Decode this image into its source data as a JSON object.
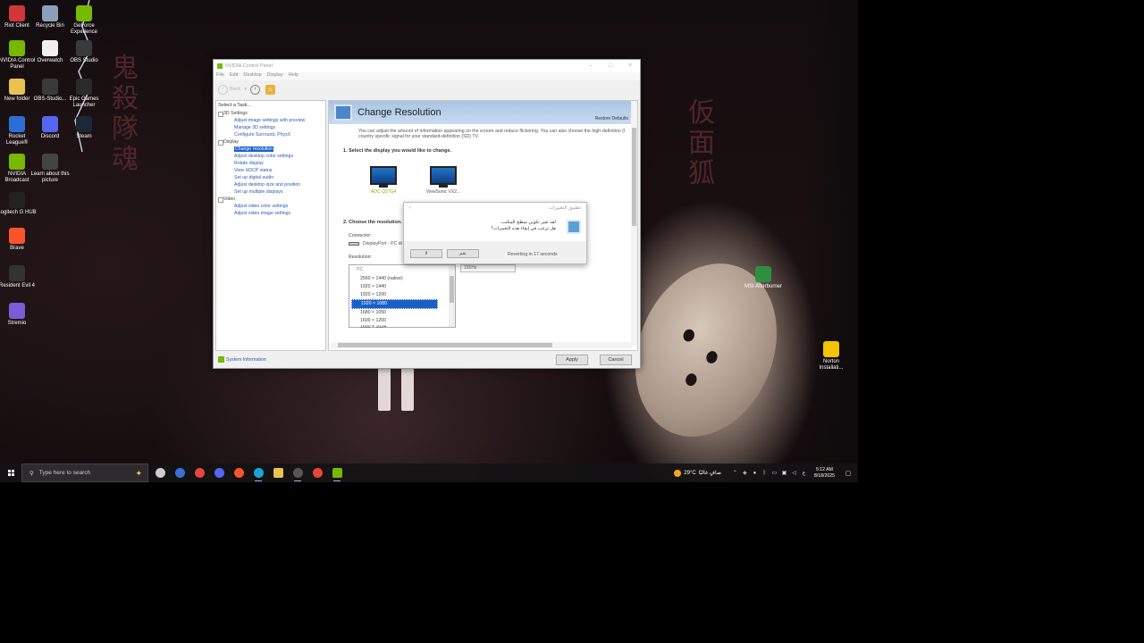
{
  "desktop": {
    "icons": [
      {
        "label": "Riot Client",
        "icon": "riot-client-icon",
        "color": "#d13639"
      },
      {
        "label": "Recycle Bin",
        "icon": "recycle-bin-icon",
        "color": "#8aa0b8"
      },
      {
        "label": "GeForce Experience",
        "icon": "geforce-experience-icon",
        "color": "#76b900"
      },
      {
        "label": "NVIDIA Control Panel",
        "icon": "nvidia-control-panel-icon",
        "color": "#76b900"
      },
      {
        "label": "Overwatch",
        "icon": "overwatch-icon",
        "color": "#f0f0f0"
      },
      {
        "label": "OBS Studio",
        "icon": "obs-studio-icon",
        "color": "#3a3a3a"
      },
      {
        "label": "New folder",
        "icon": "folder-icon",
        "color": "#e8c352"
      },
      {
        "label": "OBS-Studio...",
        "icon": "obs-studio-installer-icon",
        "color": "#3a3a3a"
      },
      {
        "label": "Epic Games Launcher",
        "icon": "epic-games-icon",
        "color": "#2a2a2a"
      },
      {
        "label": "Rocket League®",
        "icon": "rocket-league-icon",
        "color": "#2b6fd6"
      },
      {
        "label": "Discord",
        "icon": "discord-icon",
        "color": "#5865f2"
      },
      {
        "label": "Steam",
        "icon": "steam-icon",
        "color": "#1b2838"
      },
      {
        "label": "NVIDIA Broadcast",
        "icon": "nvidia-broadcast-icon",
        "color": "#76b900"
      },
      {
        "label": "Learn about this picture",
        "icon": "learn-picture-icon",
        "color": "#444444"
      },
      {
        "label": "Logitech G HUB",
        "icon": "logitech-ghub-icon",
        "color": "#222222"
      },
      {
        "label": "Brave",
        "icon": "brave-icon",
        "color": "#fb542b"
      },
      {
        "label": "Resident Evil 4",
        "icon": "resident-evil-icon",
        "color": "#333333"
      },
      {
        "label": "Stremio",
        "icon": "stremio-icon",
        "color": "#7b5bd6"
      },
      {
        "label": "MSI Afterburner",
        "icon": "msi-afterburner-icon",
        "color": "#2f8f3f"
      },
      {
        "label": "Norton Installati...",
        "icon": "norton-installer-icon",
        "color": "#f4c400"
      }
    ]
  },
  "window": {
    "title": "NVIDIA Control Panel",
    "menu": [
      "File",
      "Edit",
      "Desktop",
      "Display",
      "Help"
    ],
    "back_label": "Back",
    "tasks_header": "Select a Task...",
    "groups": [
      {
        "label": "3D Settings",
        "links": [
          "Adjust image settings with preview",
          "Manage 3D settings",
          "Configure Surround, PhysX"
        ]
      },
      {
        "label": "Display",
        "links": [
          "Change resolution",
          "Adjust desktop color settings",
          "Rotate display",
          "View HDCP status",
          "Set up digital audio",
          "Adjust desktop size and position",
          "Set up multiple displays"
        ]
      },
      {
        "label": "Video",
        "links": [
          "Adjust video color settings",
          "Adjust video image settings"
        ]
      }
    ],
    "selected_link": "Change resolution",
    "system_info": "System Information",
    "page": {
      "title": "Change Resolution",
      "restore": "Restore Defaults",
      "description": "You can adjust the amount of information appearing on the screen and reduce flickering. You can also choose the high-definition (I country specific signal for your standard-definition (SD) TV.",
      "step1": "1. Select the display you would like to change.",
      "displays": [
        "AOC Q27G4",
        "ViewSonic VX2..."
      ],
      "step2": "2. Choose the resolution.",
      "connector_label": "Connector:",
      "connector_value": "DisplayPort - PC di",
      "resolution_label": "Resolution:",
      "res_category": "PC",
      "resolutions": [
        "2560 × 1440 (native)",
        "1920 × 1440",
        "1920 × 1200",
        "1920 × 1080",
        "1680 × 1050",
        "1600 × 1200",
        "1600 × 1024"
      ],
      "selected_resolution": "1920 × 1080",
      "refresh_value": "165Hz"
    },
    "apply": "Apply",
    "cancel": "Cancel"
  },
  "dialog": {
    "title": "تطبيق التغييرات",
    "message_line1": "لقد تغير تكوين سطح المكتب.",
    "message_line2": "هل ترغب في إبقاء هذه التغييرات؟",
    "yes": "نعم",
    "no": "لا",
    "countdown": "Reverting in 17 seconds"
  },
  "taskbar": {
    "search_placeholder": "Type here to search",
    "apps": [
      {
        "icon": "task-view-icon",
        "color": "#cccccc"
      },
      {
        "icon": "copilot-icon",
        "color": "#3b6fd6"
      },
      {
        "icon": "chrome-icon",
        "color": "#e8453c"
      },
      {
        "icon": "discord-icon",
        "color": "#5865f2"
      },
      {
        "icon": "brave-icon",
        "color": "#fb542b"
      },
      {
        "icon": "edge-icon",
        "color": "#1fa0d8"
      },
      {
        "icon": "file-explorer-icon",
        "color": "#e8c352"
      },
      {
        "icon": "obs-icon",
        "color": "#555555"
      },
      {
        "icon": "chrome-icon",
        "color": "#e8453c"
      },
      {
        "icon": "nvidia-icon",
        "color": "#76b900"
      }
    ],
    "weather_temp": "29°C",
    "weather_text": "صافٍ غالبًا",
    "lang": "ع",
    "time": "5:12 AM",
    "date": "8/18/2025"
  }
}
